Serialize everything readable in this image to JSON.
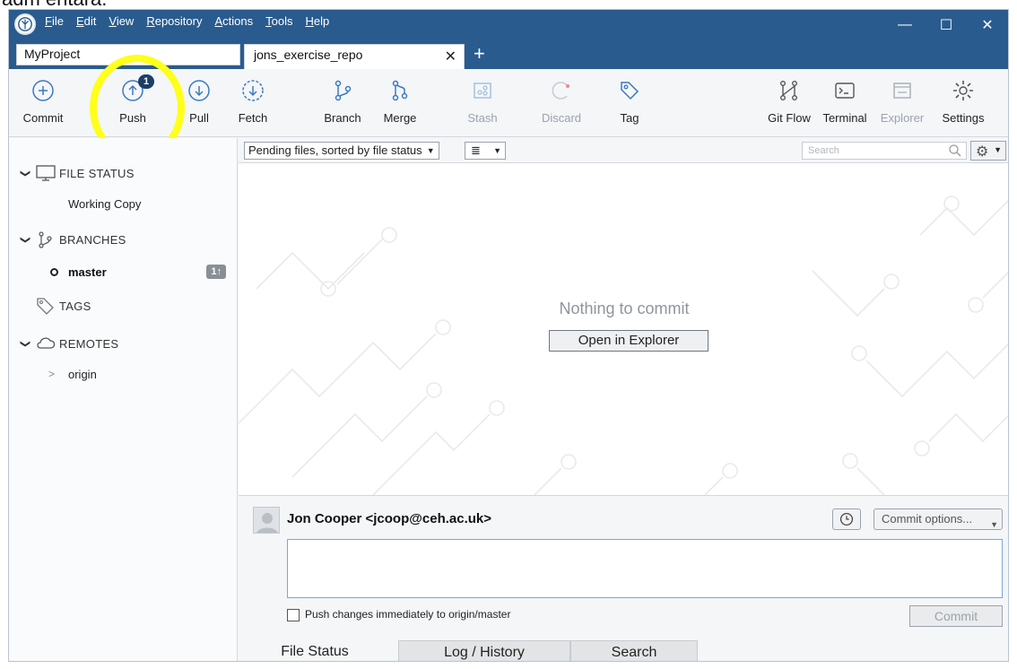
{
  "window": {
    "menu": [
      {
        "label": "File",
        "key": "F"
      },
      {
        "label": "Edit",
        "key": "E"
      },
      {
        "label": "View",
        "key": "V"
      },
      {
        "label": "Repository",
        "key": "R"
      },
      {
        "label": "Actions",
        "key": "A"
      },
      {
        "label": "Tools",
        "key": "T"
      },
      {
        "label": "Help",
        "key": "H"
      }
    ],
    "controls": {
      "minimize": "—",
      "maximize": "☐",
      "close": "✕"
    }
  },
  "tabs": {
    "project": "MyProject",
    "repo": "jons_exercise_repo",
    "close": "✕",
    "add": "+"
  },
  "toolbar": {
    "commit": "Commit",
    "push": "Push",
    "push_badge": "1",
    "pull": "Pull",
    "fetch": "Fetch",
    "branch": "Branch",
    "merge": "Merge",
    "stash": "Stash",
    "discard": "Discard",
    "tag": "Tag",
    "gitflow": "Git Flow",
    "terminal": "Terminal",
    "explorer": "Explorer",
    "settings": "Settings"
  },
  "sidebar": {
    "file_status": "FILE STATUS",
    "working_copy": "Working Copy",
    "branches": "BRANCHES",
    "master": "master",
    "master_count": "1↑",
    "tags": "TAGS",
    "remotes": "REMOTES",
    "origin": "origin"
  },
  "filterbar": {
    "sort": "Pending files, sorted by file status",
    "view": "≣",
    "search_placeholder": "Search"
  },
  "main": {
    "empty_message": "Nothing to commit",
    "open_explorer": "Open in Explorer"
  },
  "commit": {
    "author": "Jon Cooper <jcoop@ceh.ac.uk>",
    "options": "Commit options...",
    "push_label": "Push changes immediately to origin/master",
    "commit_button": "Commit"
  },
  "bottom_tabs": {
    "file_status": "File Status",
    "log": "Log / History",
    "search": "Search"
  },
  "colors": {
    "title_bar": "#2a5b8e",
    "highlight": "#ffff1a",
    "accent": "#3b78c4"
  }
}
